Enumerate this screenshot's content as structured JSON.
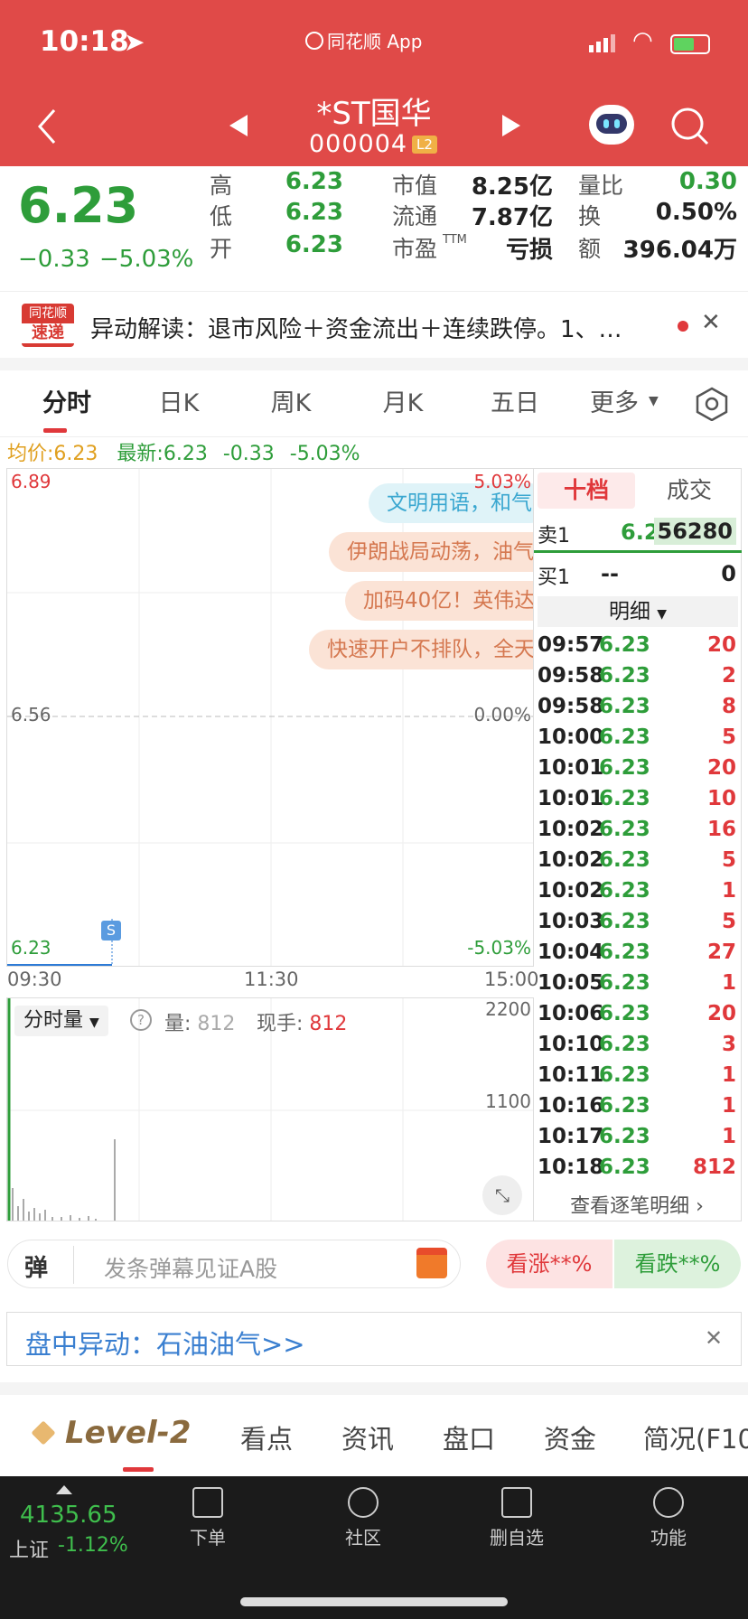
{
  "status": {
    "time": "10:18",
    "carrier": "同花顺 App"
  },
  "nav": {
    "title": "*ST国华",
    "code": "000004",
    "level_badge": "L2"
  },
  "quote": {
    "price": "6.23",
    "change": "−0.33",
    "change_pct": "−5.03%",
    "rows": [
      {
        "l1": "高",
        "v1": "6.23",
        "l2": "市值",
        "v2": "8.25亿",
        "l3": "量比",
        "v3": "0.30"
      },
      {
        "l1": "低",
        "v1": "6.23",
        "l2": "流通",
        "v2": "7.87亿",
        "l3": "换",
        "v3": "0.50%"
      },
      {
        "l1": "开",
        "v1": "6.23",
        "l2": "市盈",
        "l2sup": "TTM",
        "v2": "亏损",
        "l3": "额",
        "v3": "396.04万"
      }
    ]
  },
  "news": {
    "logo_top": "同花顺",
    "logo_bottom": "速递",
    "text": "异动解读：退市风险＋资金流出＋连续跌停。1、…"
  },
  "tabs": [
    "分时",
    "日K",
    "周K",
    "月K",
    "五日",
    "更多"
  ],
  "chart_info": {
    "avg_label": "均价:",
    "avg": "6.23",
    "latest_label": "最新:",
    "latest": "6.23",
    "chg": "-0.33",
    "chg_pct": "-5.03%"
  },
  "chart": {
    "y_top": "6.89",
    "y_mid": "6.56",
    "y_bottom": "6.23",
    "pct_top": "5.03%",
    "pct_mid": "0.00%",
    "pct_bottom": "-5.03%",
    "x_start": "09:30",
    "x_mid": "11:30",
    "x_end": "15:00",
    "marker": "S"
  },
  "bubbles": [
    "文明用语，和气",
    "伊朗战局动荡，油气",
    "加码40亿！英伟达",
    "快速开户不排队，全天"
  ],
  "volume": {
    "selector": "分时量",
    "label": "量:",
    "value": "812",
    "hand_label": "现手:",
    "hand": "812",
    "y_top": "2200",
    "y_mid": "1100"
  },
  "orderbook": {
    "tab_active": "十档",
    "tab_other": "成交",
    "sell": {
      "label": "卖1",
      "price": "6.23",
      "qty": "56280"
    },
    "buy": {
      "label": "买1",
      "price": "--",
      "qty": "0"
    },
    "detail_label": "明细",
    "trades": [
      {
        "t": "09:57",
        "p": "6.23",
        "q": "20"
      },
      {
        "t": "09:58",
        "p": "6.23",
        "q": "2"
      },
      {
        "t": "09:58",
        "p": "6.23",
        "q": "8"
      },
      {
        "t": "10:00",
        "p": "6.23",
        "q": "5"
      },
      {
        "t": "10:01",
        "p": "6.23",
        "q": "20"
      },
      {
        "t": "10:01",
        "p": "6.23",
        "q": "10"
      },
      {
        "t": "10:02",
        "p": "6.23",
        "q": "16"
      },
      {
        "t": "10:02",
        "p": "6.23",
        "q": "5"
      },
      {
        "t": "10:02",
        "p": "6.23",
        "q": "1"
      },
      {
        "t": "10:03",
        "p": "6.23",
        "q": "5"
      },
      {
        "t": "10:04",
        "p": "6.23",
        "q": "27"
      },
      {
        "t": "10:05",
        "p": "6.23",
        "q": "1"
      },
      {
        "t": "10:06",
        "p": "6.23",
        "q": "20"
      },
      {
        "t": "10:10",
        "p": "6.23",
        "q": "3"
      },
      {
        "t": "10:11",
        "p": "6.23",
        "q": "1"
      },
      {
        "t": "10:16",
        "p": "6.23",
        "q": "1"
      },
      {
        "t": "10:17",
        "p": "6.23",
        "q": "1"
      },
      {
        "t": "10:18",
        "p": "6.23",
        "q": "812"
      }
    ],
    "view_all": "查看逐笔明细 ›"
  },
  "danmu": {
    "icon": "弹",
    "placeholder": "发条弹幕见证A股",
    "rise": "看涨**%",
    "fall": "看跌**%"
  },
  "alert": {
    "text": "盘中异动：石油油气>>"
  },
  "bottom_tabs": [
    "Level-2",
    "看点",
    "资讯",
    "盘口",
    "资金",
    "简况(F10"
  ],
  "footer": {
    "index_value": "4135.65",
    "index_name": "上证",
    "index_pct": "-1.12%",
    "items": [
      "下单",
      "社区",
      "删自选",
      "功能"
    ]
  }
}
